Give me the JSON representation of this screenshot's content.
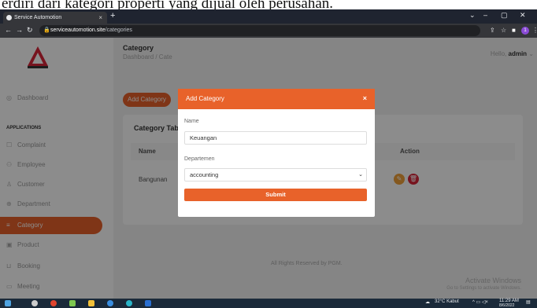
{
  "caption": "erdiri dari kategori properti yang dijual oleh perusahan.",
  "browser": {
    "tab_title": "Service Automotion",
    "tab_close": "×",
    "new_tab": "+",
    "url_domain": "serviceautomotion.site",
    "url_path": "/categories",
    "win_minimize": "–",
    "win_maximize": "▢",
    "win_close": "✕",
    "win_chevron": "⌄",
    "ext_badge": "1"
  },
  "sidebar": {
    "dashboard": "Dashboard",
    "section": "APPLICATIONS",
    "items": [
      {
        "label": "Complaint"
      },
      {
        "label": "Employee"
      },
      {
        "label": "Customer"
      },
      {
        "label": "Department"
      },
      {
        "label": "Category"
      },
      {
        "label": "Product"
      },
      {
        "label": "Booking"
      },
      {
        "label": "Meeting"
      }
    ]
  },
  "main": {
    "page_title": "Category",
    "breadcrumb": "Dashboard / Cate",
    "greeting": "Hello,",
    "username": "admin",
    "add_button": "Add Category",
    "table_title": "Category Tab",
    "col_name": "Name",
    "col_action": "Action",
    "rows": [
      {
        "name": "Bangunan"
      }
    ],
    "footer": "All Rights Reserved by PGM.",
    "watermark_title": "Activate Windows",
    "watermark_sub": "Go to Settings to activate Windows."
  },
  "modal": {
    "title": "Add Category",
    "close": "×",
    "name_label": "Name",
    "name_value": "Keuangan",
    "dept_label": "Departemen",
    "dept_value": "accounting",
    "submit": "Submit"
  },
  "taskbar": {
    "weather": "32°C Kabut",
    "time": "11:29 AM",
    "date": "8/6/2022"
  },
  "colors": {
    "accent": "#e8622a",
    "delete": "#d9263a",
    "edit": "#f0a13a"
  }
}
